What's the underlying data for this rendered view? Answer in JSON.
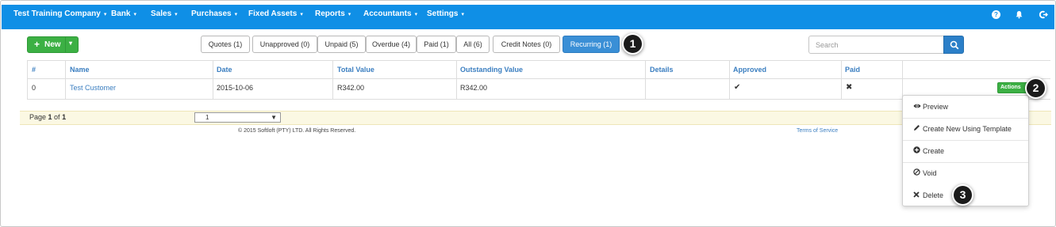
{
  "navbar": {
    "items": [
      {
        "label": "Test Training Company"
      },
      {
        "label": "Bank"
      },
      {
        "label": "Sales"
      },
      {
        "label": "Purchases"
      },
      {
        "label": "Fixed Assets"
      },
      {
        "label": "Reports"
      },
      {
        "label": "Accountants"
      },
      {
        "label": "Settings"
      }
    ],
    "caret": "▾",
    "right_icons": [
      "help-icon",
      "bell-icon",
      "logout-icon"
    ],
    "color": "#0f8fe6"
  },
  "toolbar": {
    "new_label": "New",
    "filters": [
      {
        "label": "Quotes (1)"
      },
      {
        "label": "Unapproved (0)"
      },
      {
        "label": "Unpaid (5)"
      },
      {
        "label": "Overdue (4)"
      },
      {
        "label": "Paid (1)"
      },
      {
        "label": "All (6)"
      },
      {
        "label": "Credit Notes (0)"
      },
      {
        "label": "Recurring (1)",
        "active": true
      }
    ],
    "search_placeholder": "Search"
  },
  "callouts": [
    "1",
    "2",
    "3"
  ],
  "table": {
    "columns": [
      "#",
      "Name",
      "Date",
      "Total Value",
      "Outstanding Value",
      "Details",
      "Approved",
      "Paid"
    ],
    "rows": [
      {
        "num": "0",
        "name": "Test Customer",
        "date": "2015-10-06",
        "total": "R342.00",
        "outstanding": "R342.00",
        "details": "",
        "approved": "✔",
        "paid": "✖",
        "actions": "Actions"
      }
    ]
  },
  "pager": {
    "prefix": "Page ",
    "page": "1",
    "of": " of ",
    "total": "1",
    "select_value": "1"
  },
  "footer": {
    "copyright": "© 2015 Softloft (PTY) LTD. All Rights Reserved.",
    "terms": "Terms of Service"
  },
  "actions_menu": {
    "items": [
      {
        "icon": "eye-icon",
        "label": "Preview"
      },
      {
        "icon": "pencil-icon",
        "label": "Create New Using Template"
      },
      {
        "icon": "plus-circle-icon",
        "label": "Create"
      },
      {
        "icon": "ban-icon",
        "label": "Void"
      },
      {
        "icon": "times-icon",
        "label": "Delete"
      }
    ]
  },
  "colors": {
    "primary": "#0f8fe6",
    "success": "#3cb044",
    "active_filter": "#3a8fd6",
    "link": "#3a7ec0"
  }
}
